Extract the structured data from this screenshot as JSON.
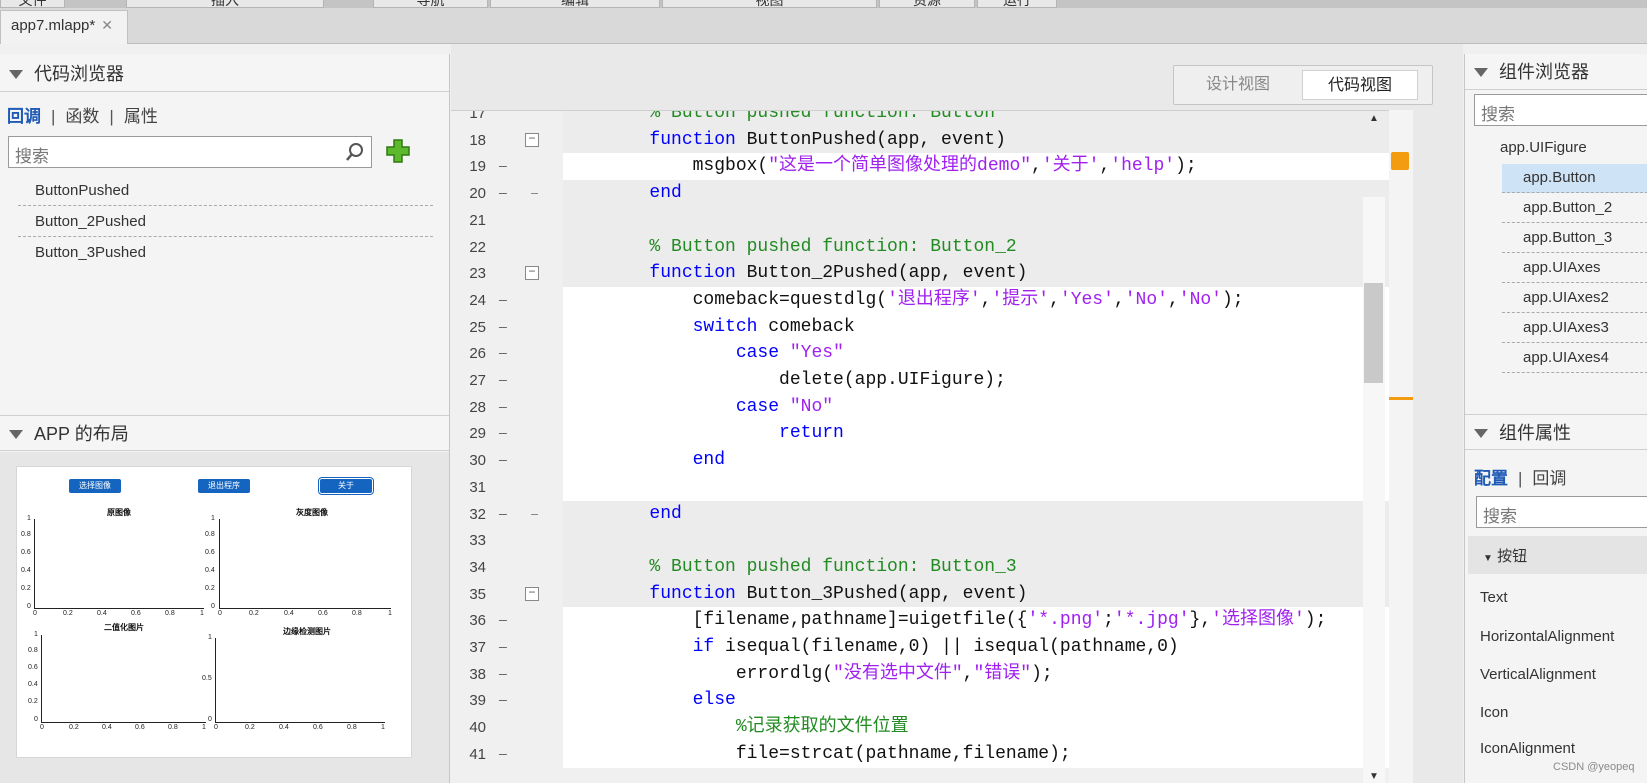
{
  "menu": [
    "文件",
    "插入",
    "导航",
    "编辑",
    "视图",
    "资源",
    "运行"
  ],
  "file_tab": {
    "label": "app7.mlapp*",
    "close": "✕"
  },
  "code_browser": {
    "title": "代码浏览器",
    "tabs": [
      "回调",
      "函数",
      "属性"
    ],
    "search_placeholder": "搜索",
    "items": [
      "ButtonPushed",
      "Button_2Pushed",
      "Button_3Pushed"
    ]
  },
  "app_layout": {
    "title": "APP 的布局",
    "buttons": [
      "选择图像",
      "退出程序",
      "关于"
    ],
    "axes_titles": [
      "原图像",
      "灰度图像",
      "二值化图片",
      "边缘检测图片"
    ],
    "y_ticks": [
      "1",
      "0.8",
      "0.6",
      "0.4",
      "0.2",
      "0"
    ],
    "x_ticks": [
      "0",
      "0.2",
      "0.4",
      "0.6",
      "0.8",
      "1"
    ],
    "y_ticks_axes4": [
      "1",
      "0.5",
      "0"
    ]
  },
  "view_toggle": {
    "design": "设计视图",
    "code": "代码视图"
  },
  "code_lines": [
    {
      "n": "17",
      "fold": "",
      "bg": "grey",
      "parts": [
        [
          "cmt",
          "        % Button pushed function: Button"
        ]
      ]
    },
    {
      "n": "18",
      "fold": "box",
      "bg": "grey",
      "parts": [
        [
          "kw",
          "        function"
        ],
        [
          "",
          " ButtonPushed(app, event)"
        ]
      ]
    },
    {
      "n": "19",
      "fold": "dash",
      "bg": "white",
      "parts": [
        [
          "",
          "            msgbox("
        ],
        [
          "str",
          "\"这是一个简单图像处理的demo\""
        ],
        [
          "",
          ","
        ],
        [
          "str",
          "'关于'"
        ],
        [
          "",
          ","
        ],
        [
          "str",
          "'help'"
        ],
        [
          "",
          ");"
        ]
      ]
    },
    {
      "n": "20",
      "fold": "dash-end",
      "bg": "grey",
      "parts": [
        [
          "kw",
          "        end"
        ]
      ]
    },
    {
      "n": "21",
      "fold": "",
      "bg": "grey",
      "parts": [
        [
          "",
          ""
        ]
      ]
    },
    {
      "n": "22",
      "fold": "",
      "bg": "grey",
      "parts": [
        [
          "cmt",
          "        % Button pushed function: Button_2"
        ]
      ]
    },
    {
      "n": "23",
      "fold": "box",
      "bg": "grey",
      "parts": [
        [
          "kw",
          "        function"
        ],
        [
          "",
          " Button_2Pushed(app, event)"
        ]
      ]
    },
    {
      "n": "24",
      "fold": "dash",
      "bg": "white",
      "parts": [
        [
          "",
          "            comeback=questdlg("
        ],
        [
          "str",
          "'退出程序'"
        ],
        [
          "",
          ","
        ],
        [
          "str",
          "'提示'"
        ],
        [
          "",
          ","
        ],
        [
          "str",
          "'Yes'"
        ],
        [
          "",
          ","
        ],
        [
          "str",
          "'No'"
        ],
        [
          "",
          ","
        ],
        [
          "str",
          "'No'"
        ],
        [
          "",
          ");"
        ]
      ]
    },
    {
      "n": "25",
      "fold": "dash",
      "bg": "white",
      "parts": [
        [
          "kw",
          "            switch"
        ],
        [
          "",
          " comeback"
        ]
      ]
    },
    {
      "n": "26",
      "fold": "dash",
      "bg": "white",
      "parts": [
        [
          "kw",
          "                case"
        ],
        [
          "",
          " "
        ],
        [
          "str",
          "\"Yes\""
        ]
      ]
    },
    {
      "n": "27",
      "fold": "dash",
      "bg": "white",
      "parts": [
        [
          "",
          "                    delete(app.UIFigure);"
        ]
      ]
    },
    {
      "n": "28",
      "fold": "dash",
      "bg": "white",
      "parts": [
        [
          "kw",
          "                case"
        ],
        [
          "",
          " "
        ],
        [
          "str",
          "\"No\""
        ]
      ]
    },
    {
      "n": "29",
      "fold": "dash",
      "bg": "white",
      "parts": [
        [
          "kw",
          "                    return"
        ]
      ]
    },
    {
      "n": "30",
      "fold": "dash",
      "bg": "white",
      "parts": [
        [
          "kw",
          "            end"
        ]
      ]
    },
    {
      "n": "31",
      "fold": "",
      "bg": "white",
      "parts": [
        [
          "",
          ""
        ]
      ]
    },
    {
      "n": "32",
      "fold": "dash-end",
      "bg": "grey",
      "parts": [
        [
          "kw",
          "        end"
        ]
      ]
    },
    {
      "n": "33",
      "fold": "",
      "bg": "grey",
      "parts": [
        [
          "",
          ""
        ]
      ]
    },
    {
      "n": "34",
      "fold": "",
      "bg": "grey",
      "parts": [
        [
          "cmt",
          "        % Button pushed function: Button_3"
        ]
      ]
    },
    {
      "n": "35",
      "fold": "box",
      "bg": "grey",
      "parts": [
        [
          "kw",
          "        function"
        ],
        [
          "",
          " Button_3Pushed(app, event)"
        ]
      ]
    },
    {
      "n": "36",
      "fold": "dash",
      "bg": "white",
      "parts": [
        [
          "",
          "            [filename,pathname]=uigetfile({"
        ],
        [
          "str",
          "'*.png'"
        ],
        [
          "",
          ";"
        ],
        [
          "str",
          "'*.jpg'"
        ],
        [
          "",
          "},"
        ],
        [
          "str",
          "'选择图像'"
        ],
        [
          "",
          ");"
        ]
      ]
    },
    {
      "n": "37",
      "fold": "dash",
      "bg": "white",
      "parts": [
        [
          "kw",
          "            if"
        ],
        [
          "",
          " isequal(filename,0) || isequal(pathname,0)"
        ]
      ]
    },
    {
      "n": "38",
      "fold": "dash",
      "bg": "white",
      "parts": [
        [
          "",
          "                errordlg("
        ],
        [
          "str",
          "\"没有选中文件\""
        ],
        [
          "",
          ","
        ],
        [
          "str",
          "\"错误\""
        ],
        [
          "",
          ");"
        ]
      ]
    },
    {
      "n": "39",
      "fold": "dash",
      "bg": "white",
      "parts": [
        [
          "kw",
          "            else"
        ]
      ]
    },
    {
      "n": "40",
      "fold": "",
      "bg": "white",
      "parts": [
        [
          "cmt",
          "                %记录获取的文件位置"
        ]
      ]
    },
    {
      "n": "41",
      "fold": "dash",
      "bg": "white",
      "parts": [
        [
          "",
          "                file=strcat(pathname,filename);"
        ]
      ]
    }
  ],
  "component_browser": {
    "title": "组件浏览器",
    "search_placeholder": "搜索",
    "root": "app.UIFigure",
    "children": [
      "app.Button",
      "app.Button_2",
      "app.Button_3",
      "app.UIAxes",
      "app.UIAxes2",
      "app.UIAxes3",
      "app.UIAxes4"
    ]
  },
  "component_props": {
    "title": "组件属性",
    "tabs": [
      "配置",
      "回调"
    ],
    "search_placeholder": "搜索",
    "section": "按钮",
    "props": [
      "Text",
      "HorizontalAlignment",
      "VerticalAlignment",
      "Icon",
      "IconAlignment"
    ]
  },
  "watermark": "CSDN @yeopeq",
  "colors": {
    "accent": "#1e5ab6",
    "keyword": "#0000ff",
    "string": "#a020f0",
    "comment": "#228b22",
    "warning": "#f39c12"
  }
}
